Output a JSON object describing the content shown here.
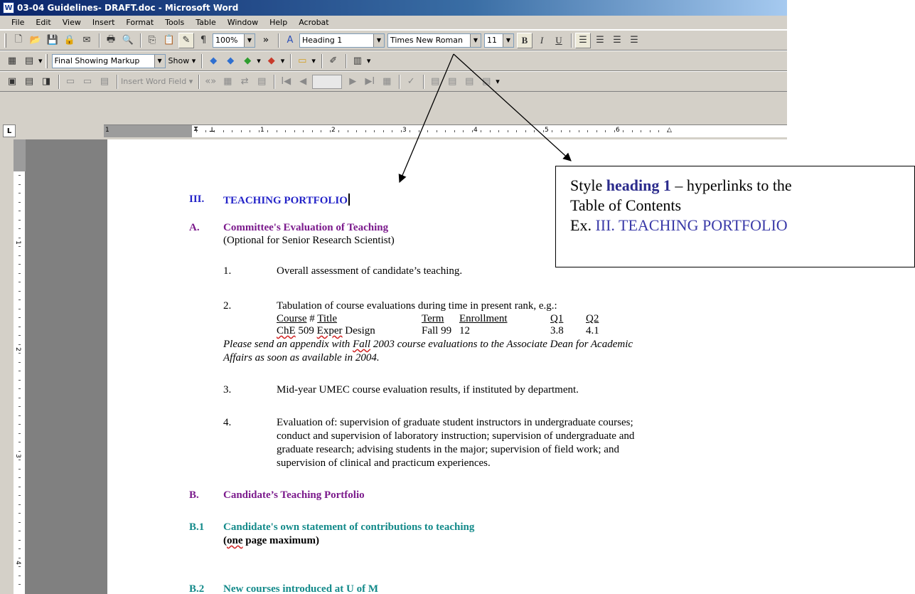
{
  "window": {
    "title": "03-04 Guidelines- DRAFT.doc - Microsoft Word",
    "app_icon": "W"
  },
  "menu": [
    "File",
    "Edit",
    "View",
    "Insert",
    "Format",
    "Tools",
    "Table",
    "Window",
    "Help",
    "Acrobat"
  ],
  "toolbar_standard": {
    "zoom": "100%",
    "style": "Heading 1",
    "font": "Times New Roman",
    "size": "11",
    "bold": "B",
    "italic": "I",
    "underline": "U",
    "pilcrow": "¶",
    "overflow": "»"
  },
  "toolbar_reviewing": {
    "display_mode": "Final Showing Markup",
    "show": "Show"
  },
  "toolbar_mailmerge": {
    "insert_word_field": "Insert Word Field",
    "nav_first": "I◀",
    "nav_prev": "◀",
    "nav_next": "▶",
    "nav_last": "▶I"
  },
  "ruler": {
    "corner": "L",
    "numbers": [
      "1",
      "1",
      "2",
      "3",
      "4",
      "5",
      "6"
    ],
    "vnumbers": [
      "1",
      "2",
      "3",
      "4"
    ]
  },
  "document": {
    "heading_num": "III.",
    "heading_text": "TEACHING PORTFOLIO",
    "a_num": "A.",
    "a_title": "Committee's Evaluation of Teaching",
    "a_note": "(Optional for Senior Research Scientist)",
    "item1_num": "1.",
    "item1": "Overall assessment of candidate’s teaching.",
    "item2_num": "2.",
    "item2": "Tabulation of course evaluations during time in present rank, e.g.:",
    "table_header": {
      "course": "Course",
      "hash_title": "#",
      "title": "Title",
      "term": "Term",
      "enrollment": "Enrollment",
      "q1": "Q1",
      "q2": "Q2"
    },
    "table_row": {
      "course_pre": "ChE",
      "course_num": "509",
      "title_a": "Exper",
      "title_b": "Design",
      "term": "Fall 99",
      "enrollment": "12",
      "q1": "3.8",
      "q2": "4.1"
    },
    "italic_1a": "Please send an appendix with ",
    "italic_1b": "Fall",
    "italic_1c": " 2003 course evaluations to the Associate Dean for Academic",
    "italic_2": "Affairs as soon as available in 2004.",
    "item3_num": "3.",
    "item3": "Mid-year UMEC course evaluation results, if instituted by department.",
    "item4_num": "4.",
    "item4_l1": "Evaluation of: supervision of graduate student instructors in undergraduate courses;",
    "item4_l2": "conduct and supervision of laboratory instruction; supervision of undergraduate and",
    "item4_l3": "graduate research; advising students in the major; supervision of field work; and",
    "item4_l4": "supervision of clinical and practicum experiences.",
    "b_num": "B.",
    "b_title": "Candidate’s Teaching Portfolio",
    "b1_num": "B.1",
    "b1_title": "Candidate's own statement of contributions to teaching",
    "b1_note_a": "(",
    "b1_note_b": "one",
    "b1_note_c": " page maximum)",
    "b2_num": "B.2",
    "b2_title": "New courses introduced at U of M"
  },
  "callout": {
    "line1_a": "Style ",
    "line1_b": "heading 1",
    "line1_c": " – hyperlinks to the",
    "line2": "Table of Contents",
    "line3_a": "Ex. ",
    "line3_b": "III. TEACHING PORTFOLIO"
  },
  "colors": {
    "heading1": "#2323c8",
    "headingA": "#7b1a8c",
    "headingB": "#138a8a",
    "titlebar": "#0a246a"
  }
}
